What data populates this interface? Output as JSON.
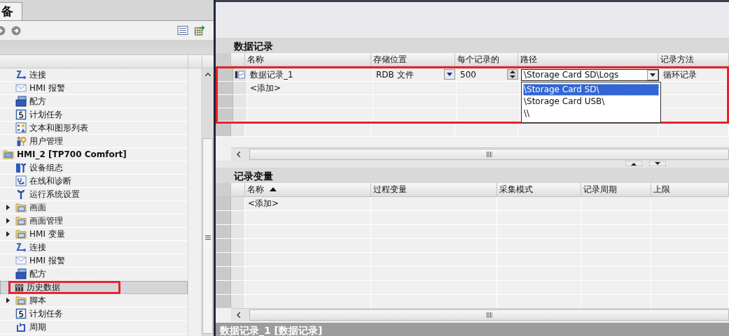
{
  "navigator": {
    "tab": "备",
    "continued_items": [
      {
        "label": "连接",
        "kind": "connection",
        "selected": false,
        "highlighted": false
      },
      {
        "label": "HMI 报警",
        "kind": "alarm",
        "selected": false,
        "highlighted": false
      },
      {
        "label": "配方",
        "kind": "recipe",
        "selected": false,
        "highlighted": false
      },
      {
        "label": "计划任务",
        "kind": "schedule",
        "selected": false,
        "highlighted": false
      },
      {
        "label": "文本和图形列表",
        "kind": "textlist",
        "selected": false,
        "highlighted": false
      },
      {
        "label": "用户管理",
        "kind": "users",
        "selected": false,
        "highlighted": false
      }
    ],
    "devices": [
      {
        "label": "HMI_2 [TP700 Comfort]",
        "kind": "device",
        "selected": false,
        "highlighted": false,
        "children": [
          {
            "label": "设备组态",
            "kind": "config",
            "selected": false,
            "highlighted": false
          },
          {
            "label": "在线和诊断",
            "kind": "diagnostics",
            "selected": false,
            "highlighted": false
          },
          {
            "label": "运行系统设置",
            "kind": "runtime",
            "selected": false,
            "highlighted": false
          },
          {
            "label": "画面",
            "kind": "folder",
            "expanded": false,
            "selected": false,
            "highlighted": false
          },
          {
            "label": "画面管理",
            "kind": "folder",
            "expanded": false,
            "selected": false,
            "highlighted": false
          },
          {
            "label": "HMI 变量",
            "kind": "folder",
            "expanded": false,
            "selected": false,
            "highlighted": false
          },
          {
            "label": "连接",
            "kind": "connection",
            "selected": false,
            "highlighted": false
          },
          {
            "label": "HMI 报警",
            "kind": "alarm",
            "selected": false,
            "highlighted": false
          },
          {
            "label": "配方",
            "kind": "recipe",
            "selected": false,
            "highlighted": false
          },
          {
            "label": "历史数据",
            "kind": "logs",
            "selected": true,
            "highlighted": true
          },
          {
            "label": "脚本",
            "kind": "folder",
            "expanded": false,
            "selected": false,
            "highlighted": false
          },
          {
            "label": "计划任务",
            "kind": "schedule",
            "selected": false,
            "highlighted": false
          },
          {
            "label": "周期",
            "kind": "cycle",
            "selected": false,
            "highlighted": false
          }
        ]
      }
    ]
  },
  "data_logs": {
    "title": "数据记录",
    "highlighted": true,
    "columns": [
      "名称",
      "存储位置",
      "每个记录的",
      "路径",
      "记录方法"
    ],
    "rows": [
      {
        "name": "数据记录_1",
        "storage": "RDB 文件",
        "records": "500",
        "path": "\\Storage Card SD\\Logs",
        "method": "循环记录",
        "path_dropdown_open": true
      }
    ],
    "add_row": "<添加>",
    "path_options": [
      {
        "label": "\\Storage Card SD\\",
        "selected": true
      },
      {
        "label": "\\Storage Card USB\\",
        "selected": false
      },
      {
        "label": "\\\\",
        "selected": false
      }
    ]
  },
  "log_tags": {
    "title": "记录变量",
    "columns": [
      {
        "label": "名称",
        "sorted": true
      },
      {
        "label": "过程变量",
        "sorted": false
      },
      {
        "label": "采集模式",
        "sorted": false
      },
      {
        "label": "记录周期",
        "sorted": false
      },
      {
        "label": "上限",
        "sorted": false
      }
    ],
    "add_row": "<添加>"
  },
  "status_bar": "数据记录_1 [数据记录]"
}
